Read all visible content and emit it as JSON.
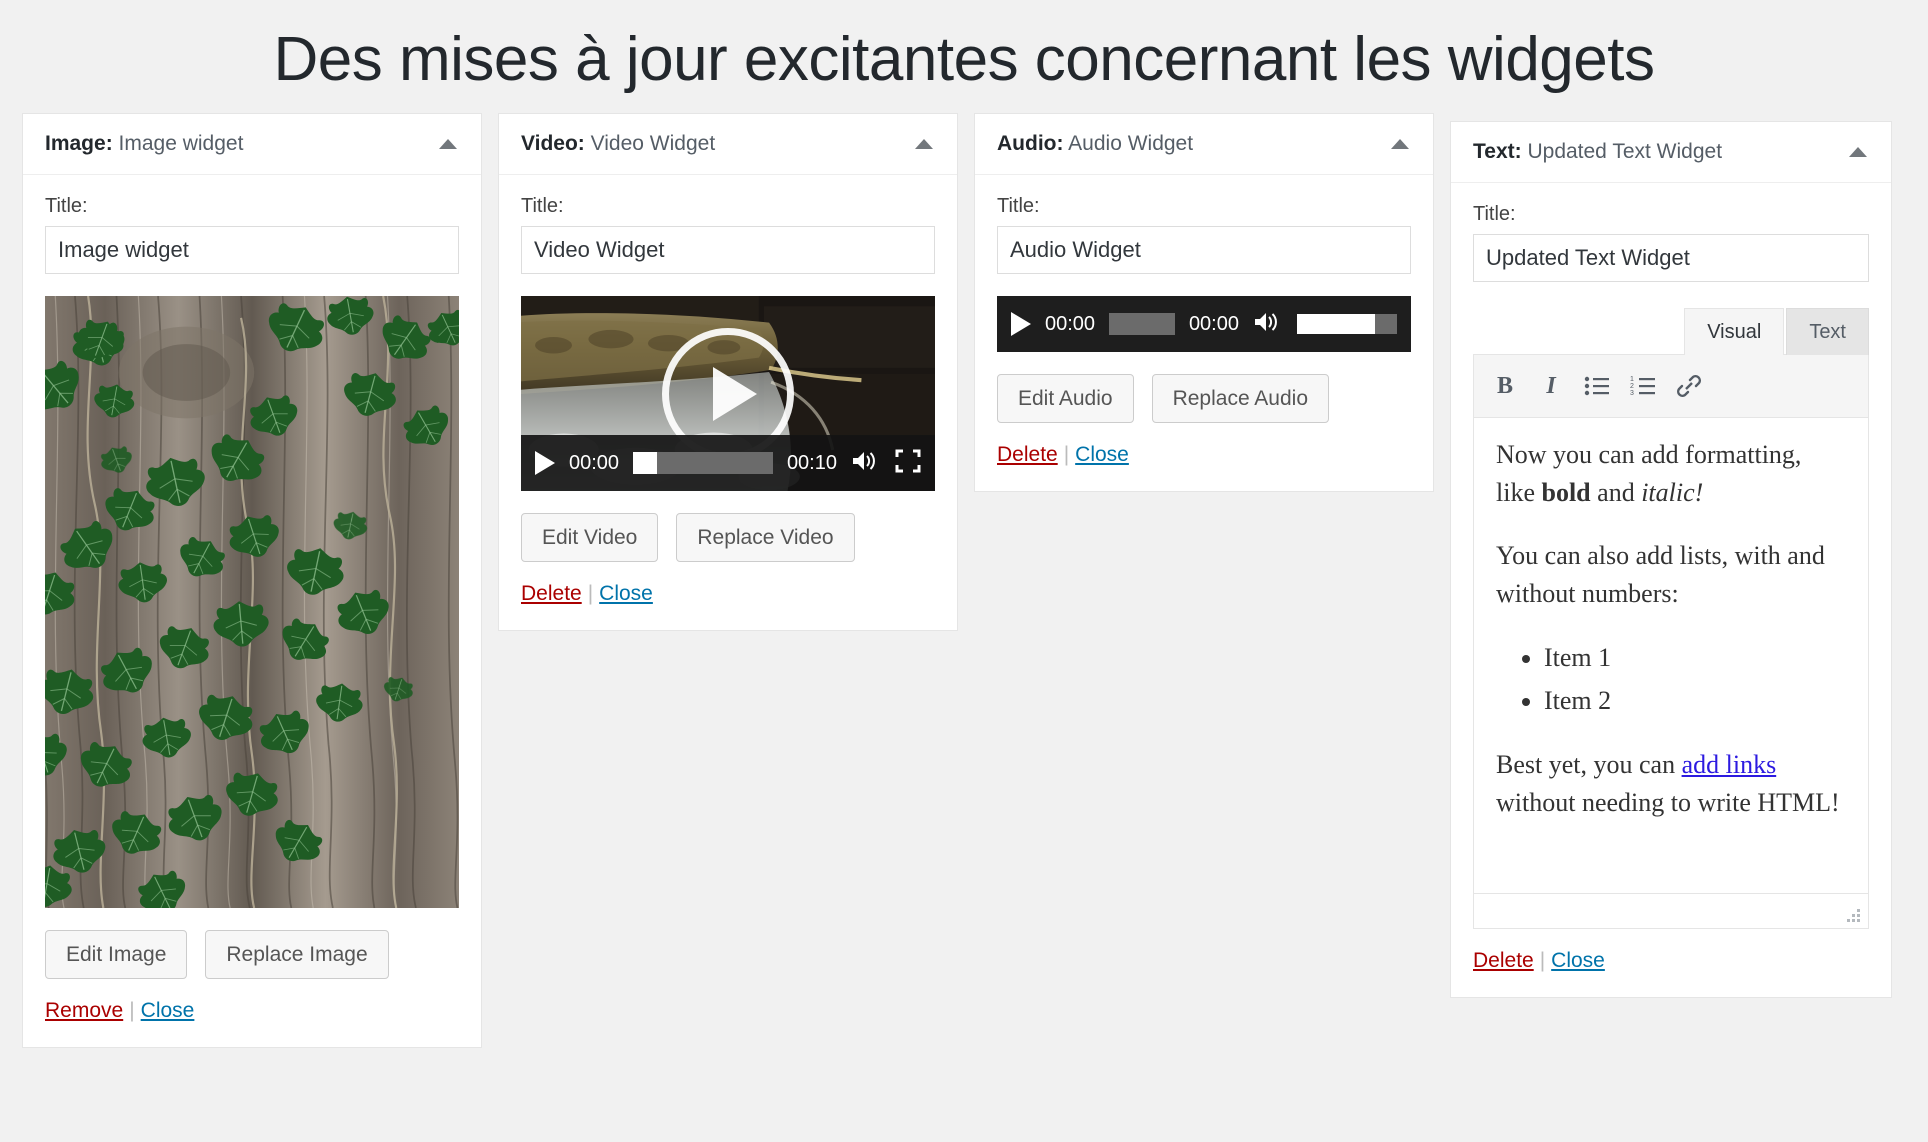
{
  "page": {
    "title": "Des mises à jour excitantes concernant les widgets"
  },
  "common": {
    "title_label": "Title:",
    "close_label": "Close",
    "delete_label": "Delete",
    "separator": "|",
    "collapse_icon": "triangle-up-icon"
  },
  "widgets": [
    {
      "id": "image",
      "type_label": "Image:",
      "name": "Image widget",
      "title_label": "Title:",
      "title_value": "Image widget",
      "media_alt": "Green ivy leaves climbing on rough tree bark",
      "buttons": {
        "edit": "Edit Image",
        "replace": "Replace Image"
      },
      "links": {
        "remove": "Remove",
        "close": "Close"
      }
    },
    {
      "id": "video",
      "type_label": "Video:",
      "name": "Video Widget",
      "title_label": "Title:",
      "title_value": "Video Widget",
      "media_alt": "Water flowing over a mossy stone ledge",
      "player": {
        "play_icon": "play-icon",
        "current_time": "00:00",
        "duration": "00:10",
        "speaker_icon": "speaker-icon",
        "fullscreen_icon": "fullscreen-icon",
        "progress_percent": 0
      },
      "buttons": {
        "edit": "Edit Video",
        "replace": "Replace Video"
      },
      "links": {
        "delete": "Delete",
        "close": "Close"
      }
    },
    {
      "id": "audio",
      "type_label": "Audio:",
      "name": "Audio Widget",
      "title_label": "Title:",
      "title_value": "Audio Widget",
      "player": {
        "play_icon": "play-icon",
        "current_time": "00:00",
        "duration": "00:00",
        "speaker_icon": "speaker-icon",
        "progress_percent": 0,
        "volume_percent": 78
      },
      "buttons": {
        "edit": "Edit Audio",
        "replace": "Replace Audio"
      },
      "links": {
        "delete": "Delete",
        "close": "Close"
      }
    },
    {
      "id": "text",
      "type_label": "Text:",
      "name": "Updated Text Widget",
      "title_label": "Title:",
      "title_value": "Updated Text Widget",
      "editor": {
        "tabs": [
          {
            "label": "Visual",
            "active": true
          },
          {
            "label": "Text",
            "active": false
          }
        ],
        "toolbar": [
          {
            "icon": "bold-icon",
            "glyph": "B"
          },
          {
            "icon": "italic-icon",
            "glyph": "I"
          },
          {
            "icon": "bullet-list-icon",
            "glyph": ""
          },
          {
            "icon": "numbered-list-icon",
            "glyph": ""
          },
          {
            "icon": "link-icon",
            "glyph": ""
          }
        ],
        "content": {
          "para1_before_bold": "Now you can add formatting, like ",
          "para1_bold": "bold",
          "para1_middle": " and ",
          "para1_italic": "italic!",
          "para2": "You can also add lists, with and without numbers:",
          "list_items": [
            "Item 1",
            "Item 2"
          ],
          "para3_before_link": "Best yet, you can ",
          "para3_link": "add links",
          "para3_after_link": " without needing to write HTML!"
        },
        "resize_handle_icon": "resize-grip-icon"
      },
      "links": {
        "delete": "Delete",
        "close": "Close"
      }
    }
  ],
  "colors": {
    "page_bg": "#f1f1f1",
    "panel_bg": "#ffffff",
    "border": "#e5e5e5",
    "delete_red": "#a00000",
    "link_blue": "#0073aa",
    "editor_link": "#2c1ae0",
    "header_text": "#23282d"
  }
}
